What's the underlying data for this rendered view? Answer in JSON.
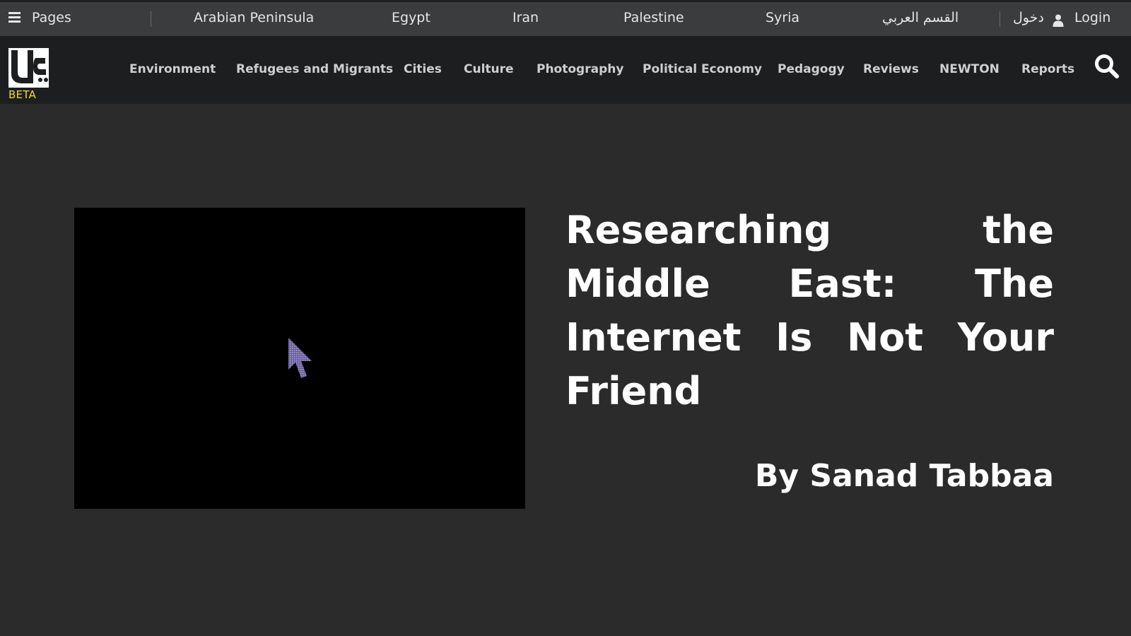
{
  "topbar": {
    "pages_label": "Pages",
    "links": [
      "Arabian Peninsula",
      "Egypt",
      "Iran",
      "Palestine",
      "Syria"
    ],
    "arabic_section": "القسم العربي",
    "arabic_login": "دخول",
    "login": "Login"
  },
  "brand": {
    "beta_label": "BETA",
    "beta_color": "#f2dd1f"
  },
  "nav": {
    "items": [
      "Environment",
      "Refugees and Migrants",
      "Cities",
      "Culture",
      "Photography",
      "Political Economy",
      "Pedagogy",
      "Reviews",
      "NEWTON",
      "Reports"
    ],
    "search_icon": "search-icon"
  },
  "article": {
    "title": "Researching the Middle East: The Internet Is Not Your Friend",
    "byline": "By Sanad Tabbaa"
  }
}
